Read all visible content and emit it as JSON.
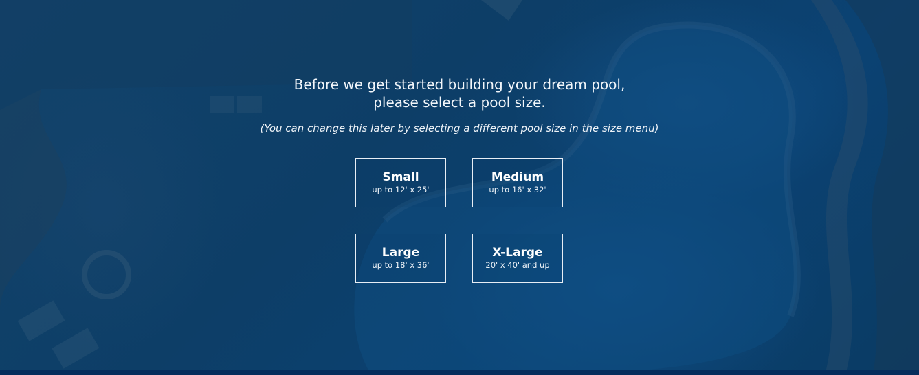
{
  "intro": {
    "line1": "Before we get started building your dream pool,",
    "line2": "please select a pool size.",
    "note": "(You can change this later by selecting a different pool size in the size menu)"
  },
  "sizes": [
    {
      "label": "Small",
      "dimensions": "up to 12' x 25'"
    },
    {
      "label": "Medium",
      "dimensions": "up to 16' x 32'"
    },
    {
      "label": "Large",
      "dimensions": "up to 18' x 36'"
    },
    {
      "label": "X-Large",
      "dimensions": "20' x 40' and up"
    }
  ],
  "colors": {
    "background": "#0a3b63",
    "bottom_bar": "#062d5c",
    "text": "#ffffff",
    "button_border": "#e8eef5"
  }
}
